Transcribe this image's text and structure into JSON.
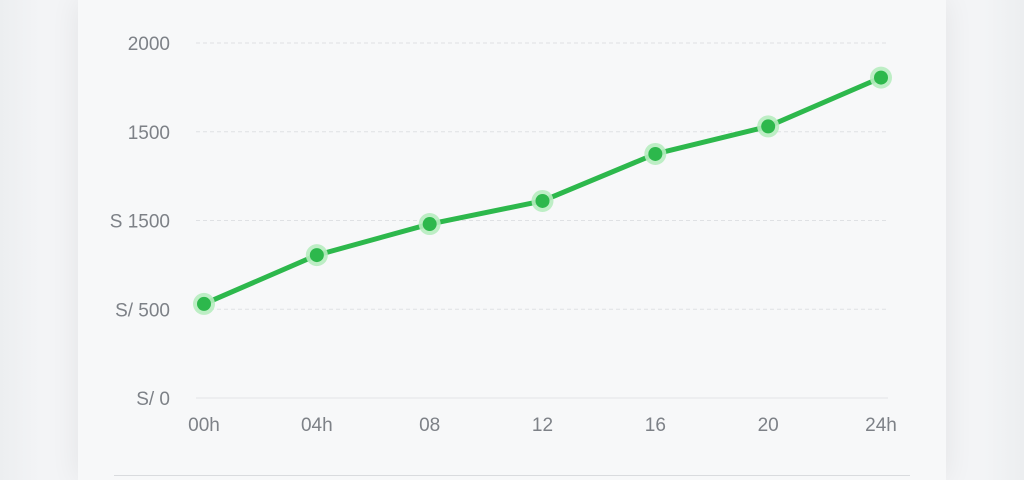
{
  "chart_data": {
    "type": "line",
    "x": [
      "00h",
      "04h",
      "08",
      "12",
      "16",
      "20",
      "24h"
    ],
    "y_ticks": [
      {
        "value": 0,
        "label": "S/ 0"
      },
      {
        "value": 500,
        "label": "S/ 500"
      },
      {
        "value": 1000,
        "label": "S 1500"
      },
      {
        "value": 1500,
        "label": "1500"
      },
      {
        "value": 2000,
        "label": "2000"
      }
    ],
    "series": [
      {
        "values": [
          530,
          805,
          980,
          1110,
          1375,
          1530,
          1805
        ]
      }
    ],
    "ylim": [
      0,
      2000
    ],
    "grid": true,
    "colors": {
      "line": "#2db84c",
      "marker_halo": "#b6ecbf",
      "grid": "#dfe1e4",
      "axis": "#e3e5e8",
      "tick_label": "#7d8187"
    }
  }
}
